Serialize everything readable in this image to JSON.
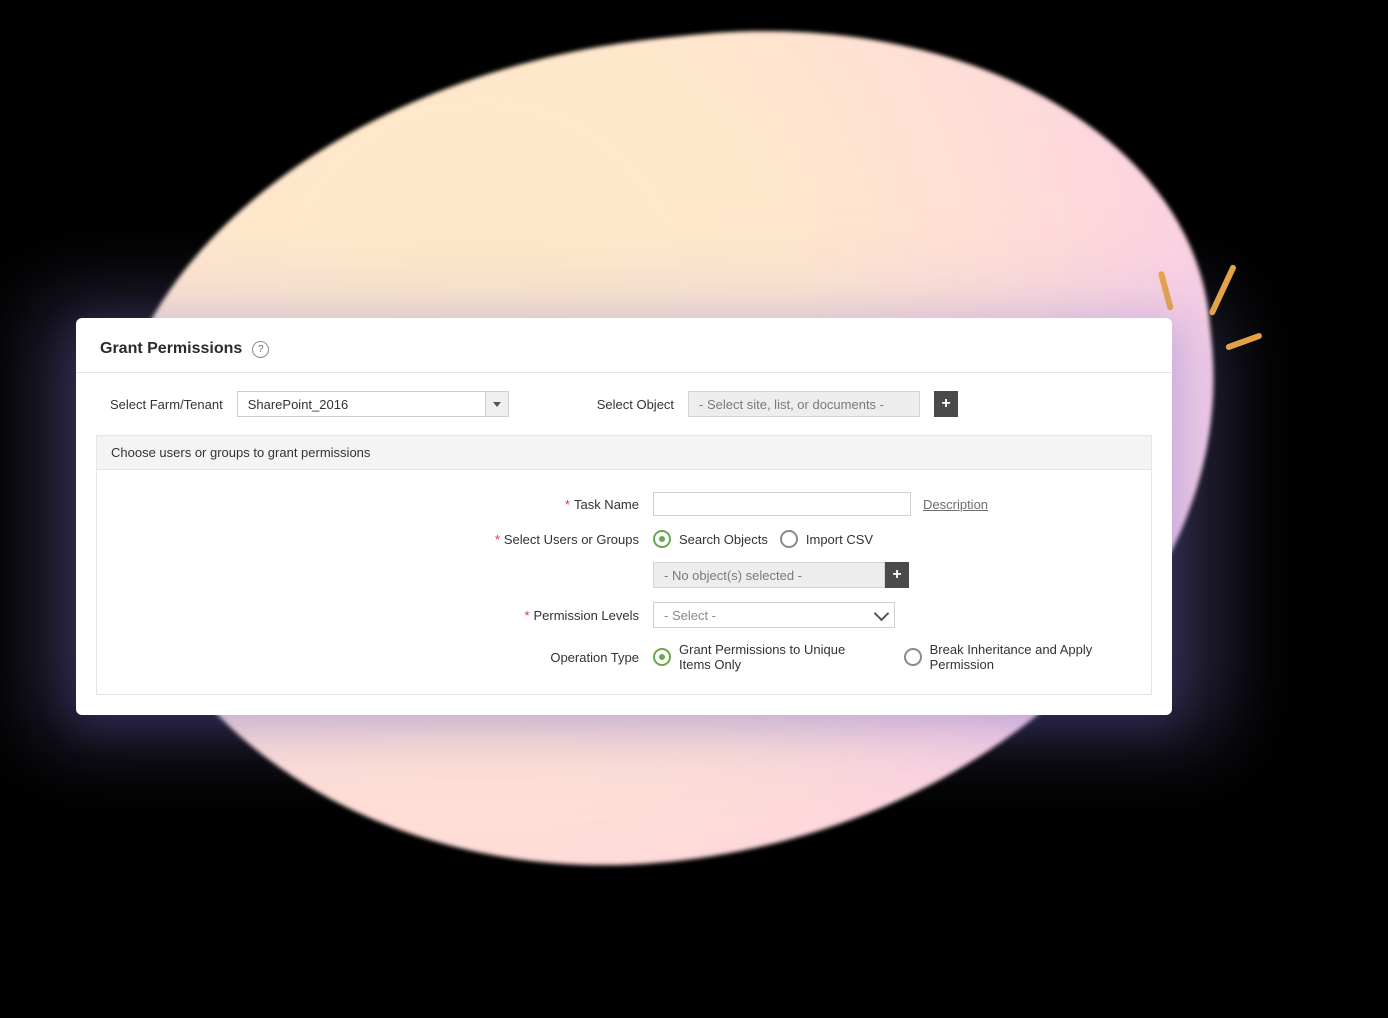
{
  "header": {
    "title": "Grant Permissions",
    "help_glyph": "?"
  },
  "top": {
    "farm_label": "Select Farm/Tenant",
    "farm_value": "SharePoint_2016",
    "object_label": "Select Object",
    "object_placeholder": "- Select site, list, or documents -",
    "plus_glyph": "+"
  },
  "section": {
    "heading": "Choose users or groups to grant permissions",
    "task_name_label": "Task Name",
    "description_link": "Description",
    "users_label": "Select Users or Groups",
    "radio_search": "Search Objects",
    "radio_import": "Import CSV",
    "objects_placeholder": "- No object(s) selected -",
    "plus_glyph": "+",
    "perm_label": "Permission Levels",
    "perm_placeholder": "- Select -",
    "op_label": "Operation Type",
    "op_radio_grant": "Grant Permissions to Unique Items Only",
    "op_radio_break": "Break Inheritance and Apply Permission"
  }
}
